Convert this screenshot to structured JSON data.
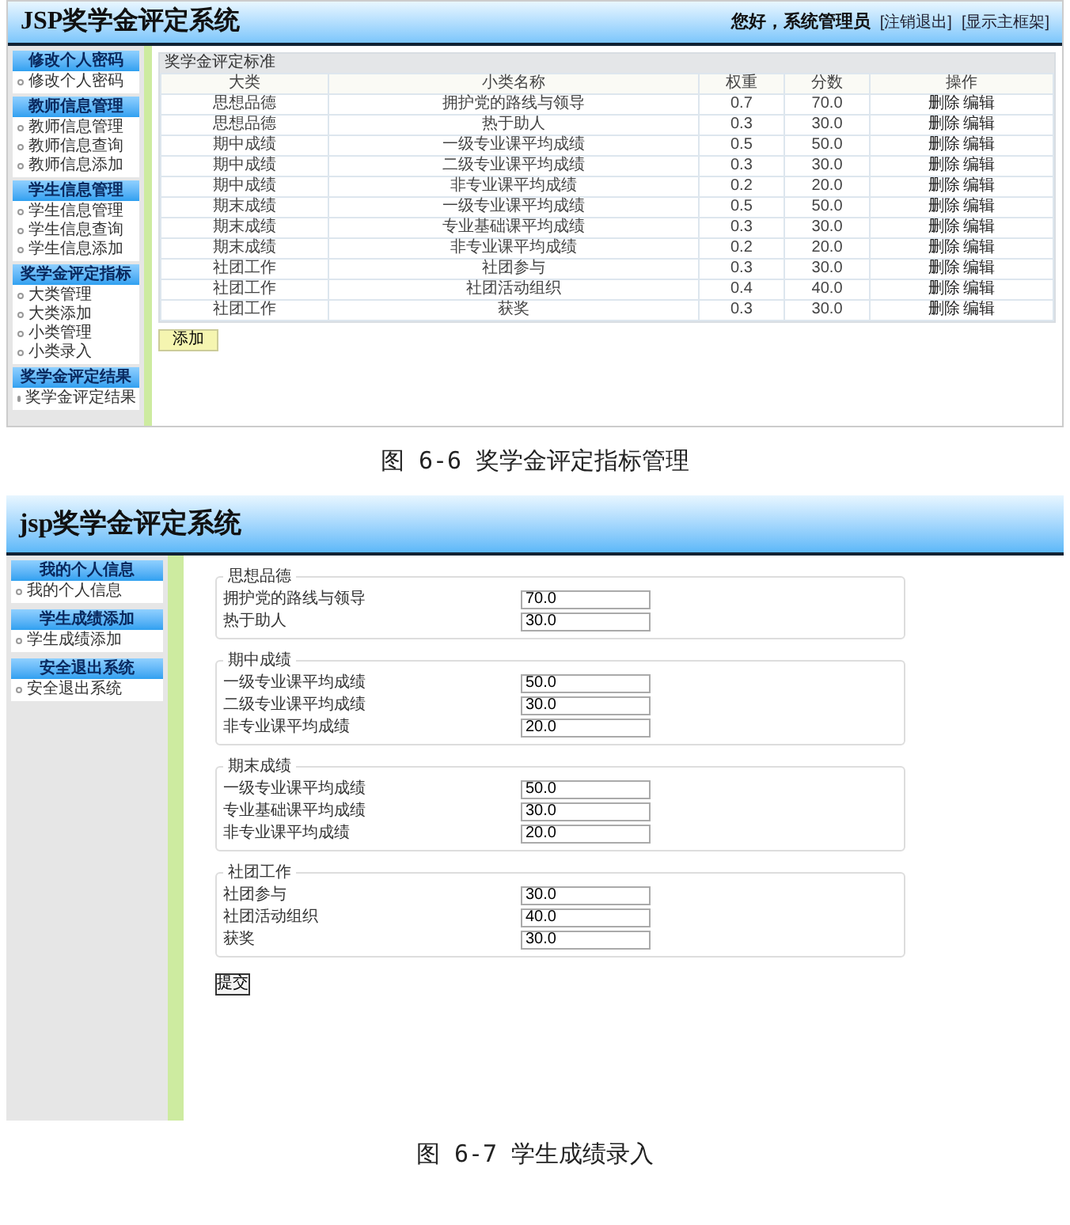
{
  "screen_1": {
    "title": "JSP奖学金评定系统",
    "greeting": "您好，系统管理员",
    "header_links": [
      "[注销退出]",
      "[显示主框架]"
    ],
    "sidebar": [
      {
        "heading": "修改个人密码",
        "items": [
          "修改个人密码"
        ]
      },
      {
        "heading": "教师信息管理",
        "items": [
          "教师信息管理",
          "教师信息查询",
          "教师信息添加"
        ]
      },
      {
        "heading": "学生信息管理",
        "items": [
          "学生信息管理",
          "学生信息查询",
          "学生信息添加"
        ]
      },
      {
        "heading": "奖学金评定指标",
        "items": [
          "大类管理",
          "大类添加",
          "小类管理",
          "小类录入"
        ]
      },
      {
        "heading": "奖学金评定结果",
        "items": [
          "奖学金评定结果"
        ]
      }
    ],
    "table": {
      "caption": "奖学金评定标准",
      "columns": [
        "大类",
        "小类名称",
        "权重",
        "分数",
        "操作"
      ],
      "rows": [
        {
          "cells": [
            "思想品德",
            "拥护党的路线与领导",
            "0.7",
            "70.0"
          ],
          "actions": [
            "删除",
            "编辑"
          ]
        },
        {
          "cells": [
            "思想品德",
            "热于助人",
            "0.3",
            "30.0"
          ],
          "actions": [
            "删除",
            "编辑"
          ]
        },
        {
          "cells": [
            "期中成绩",
            "一级专业课平均成绩",
            "0.5",
            "50.0"
          ],
          "actions": [
            "删除",
            "编辑"
          ]
        },
        {
          "cells": [
            "期中成绩",
            "二级专业课平均成绩",
            "0.3",
            "30.0"
          ],
          "actions": [
            "删除",
            "编辑"
          ]
        },
        {
          "cells": [
            "期中成绩",
            "非专业课平均成绩",
            "0.2",
            "20.0"
          ],
          "actions": [
            "删除",
            "编辑"
          ]
        },
        {
          "cells": [
            "期末成绩",
            "一级专业课平均成绩",
            "0.5",
            "50.0"
          ],
          "actions": [
            "删除",
            "编辑"
          ]
        },
        {
          "cells": [
            "期末成绩",
            "专业基础课平均成绩",
            "0.3",
            "30.0"
          ],
          "actions": [
            "删除",
            "编辑"
          ]
        },
        {
          "cells": [
            "期末成绩",
            "非专业课平均成绩",
            "0.2",
            "20.0"
          ],
          "actions": [
            "删除",
            "编辑"
          ]
        },
        {
          "cells": [
            "社团工作",
            "社团参与",
            "0.3",
            "30.0"
          ],
          "actions": [
            "删除",
            "编辑"
          ]
        },
        {
          "cells": [
            "社团工作",
            "社团活动组织",
            "0.4",
            "40.0"
          ],
          "actions": [
            "删除",
            "编辑"
          ]
        },
        {
          "cells": [
            "社团工作",
            "获奖",
            "0.3",
            "30.0"
          ],
          "actions": [
            "删除",
            "编辑"
          ]
        }
      ]
    },
    "add_button": "添加"
  },
  "caption_1": "图 6-6 奖学金评定指标管理",
  "screen_2": {
    "title": "jsp奖学金评定系统",
    "sidebar": [
      {
        "heading": "我的个人信息",
        "items": [
          "我的个人信息"
        ]
      },
      {
        "heading": "学生成绩添加",
        "items": [
          "学生成绩添加"
        ]
      },
      {
        "heading": "安全退出系统",
        "items": [
          "安全退出系统"
        ]
      }
    ],
    "groups": [
      {
        "legend": "思想品德",
        "fields": [
          {
            "label": "拥护党的路线与领导",
            "value": "70.0"
          },
          {
            "label": "热于助人",
            "value": "30.0"
          }
        ]
      },
      {
        "legend": "期中成绩",
        "fields": [
          {
            "label": "一级专业课平均成绩",
            "value": "50.0"
          },
          {
            "label": "二级专业课平均成绩",
            "value": "30.0"
          },
          {
            "label": "非专业课平均成绩",
            "value": "20.0"
          }
        ]
      },
      {
        "legend": "期末成绩",
        "fields": [
          {
            "label": "一级专业课平均成绩",
            "value": "50.0"
          },
          {
            "label": "专业基础课平均成绩",
            "value": "30.0"
          },
          {
            "label": "非专业课平均成绩",
            "value": "20.0"
          }
        ]
      },
      {
        "legend": "社团工作",
        "fields": [
          {
            "label": "社团参与",
            "value": "30.0"
          },
          {
            "label": "社团活动组织",
            "value": "40.0"
          },
          {
            "label": "获奖",
            "value": "30.0"
          }
        ]
      }
    ],
    "submit": "提交"
  },
  "caption_2": "图 6-7 学生成绩录入"
}
